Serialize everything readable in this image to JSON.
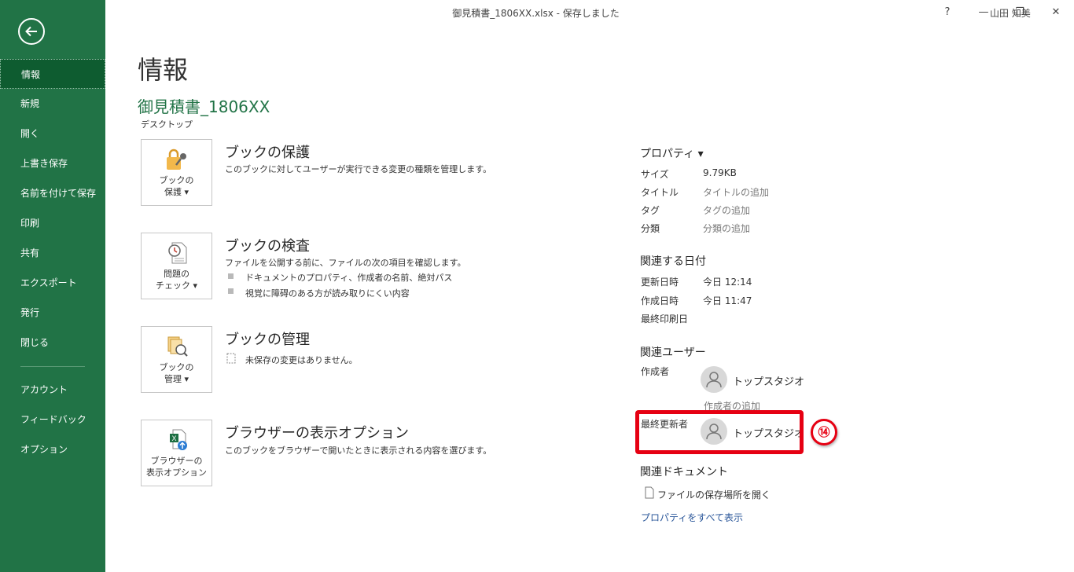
{
  "window": {
    "title": "御見積書_1806XX.xlsx  -  保存しました",
    "user": "山田 知美",
    "help": "?",
    "minimize": "—",
    "restore": "❐",
    "close": "✕"
  },
  "sidebar": {
    "items": [
      {
        "label": "情報"
      },
      {
        "label": "新規"
      },
      {
        "label": "開く"
      },
      {
        "label": "上書き保存"
      },
      {
        "label": "名前を付けて保存"
      },
      {
        "label": "印刷"
      },
      {
        "label": "共有"
      },
      {
        "label": "エクスポート"
      },
      {
        "label": "発行"
      },
      {
        "label": "閉じる"
      },
      {
        "label": "アカウント"
      },
      {
        "label": "フィードバック"
      },
      {
        "label": "オプション"
      }
    ]
  },
  "main": {
    "title": "情報",
    "file_name": "御見積書_1806XX",
    "location": "デスクトップ",
    "cards": [
      {
        "button_line1": "ブックの",
        "button_line2": "保護 ▾",
        "title": "ブックの保護",
        "description": "このブックに対してユーザーが実行できる変更の種類を管理します。"
      },
      {
        "button_line1": "問題の",
        "button_line2": "チェック ▾",
        "title": "ブックの検査",
        "description": "ファイルを公開する前に、ファイルの次の項目を確認します。",
        "bullets": [
          "ドキュメントのプロパティ、作成者の名前、絶対パス",
          "視覚に障碍のある方が読み取りにくい内容"
        ]
      },
      {
        "button_line1": "ブックの",
        "button_line2": "管理 ▾",
        "title": "ブックの管理",
        "description": "未保存の変更はありません。"
      },
      {
        "button_line1": "ブラウザーの",
        "button_line2": "表示オプション",
        "title": "ブラウザーの表示オプション",
        "description": "このブックをブラウザーで開いたときに表示される内容を選びます。"
      }
    ]
  },
  "properties": {
    "header": "プロパティ ▾",
    "size_label": "サイズ",
    "size_value": "9.79KB",
    "title_label": "タイトル",
    "title_value": "タイトルの追加",
    "tag_label": "タグ",
    "tag_value": "タグの追加",
    "category_label": "分類",
    "category_value": "分類の追加",
    "dates_header": "関連する日付",
    "modified_label": "更新日時",
    "modified_value": "今日 12:14",
    "created_label": "作成日時",
    "created_value": "今日 11:47",
    "printed_label": "最終印刷日",
    "users_header": "関連ユーザー",
    "author_label": "作成者",
    "author_name": "トップスタジオ",
    "add_author": "作成者の追加",
    "last_modified_by_label": "最終更新者",
    "last_modified_by_name": "トップスタジオ",
    "docs_header": "関連ドキュメント",
    "open_location": "ファイルの保存場所を開く",
    "show_all": "プロパティをすべて表示"
  },
  "annotation": {
    "badge": "⑭",
    "color": "#e60012"
  },
  "colors": {
    "brand": "#217346",
    "link": "#2b579a"
  }
}
